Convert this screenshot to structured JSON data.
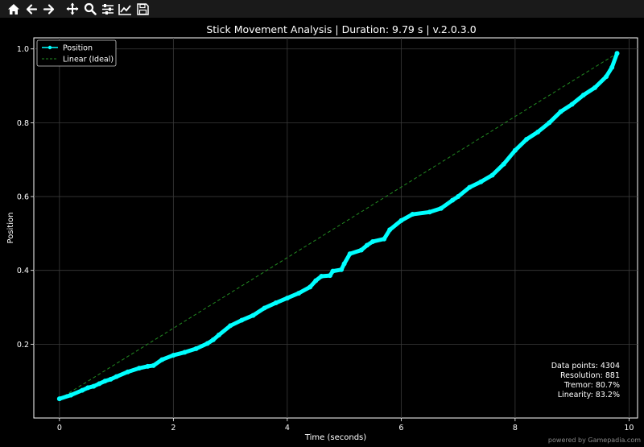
{
  "toolbar": {
    "buttons": [
      {
        "name": "home-icon"
      },
      {
        "name": "back-icon"
      },
      {
        "name": "forward-icon"
      },
      {
        "name": "pan-icon"
      },
      {
        "name": "zoom-icon"
      },
      {
        "name": "subplots-icon"
      },
      {
        "name": "edit-axes-icon"
      },
      {
        "name": "save-icon"
      }
    ],
    "icon_color": "#ffffff",
    "background": "#1a1a1a"
  },
  "chart_data": {
    "type": "line",
    "title": "Stick Movement Analysis | Duration: 9.79 s | v.2.0.3.0",
    "xlabel": "Time (seconds)",
    "ylabel": "Position",
    "xlim": [
      -0.45,
      10.15
    ],
    "ylim": [
      0.0,
      1.03
    ],
    "xticks": [
      0,
      2,
      4,
      6,
      8,
      10
    ],
    "xtick_labels": [
      "0",
      "2",
      "4",
      "6",
      "8",
      "10"
    ],
    "yticks": [
      0.2,
      0.4,
      0.6,
      0.8,
      1.0
    ],
    "ytick_labels": [
      "0.2",
      "0.4",
      "0.6",
      "0.8",
      "1.0"
    ],
    "grid": true,
    "legend_position": "top-left",
    "series": [
      {
        "name": "Position",
        "color": "#00ffff",
        "style": "solid-with-markers",
        "x": [
          0.0,
          0.2,
          0.4,
          0.5,
          0.6,
          0.7,
          0.8,
          0.9,
          1.0,
          1.2,
          1.4,
          1.55,
          1.65,
          1.8,
          2.0,
          2.2,
          2.4,
          2.6,
          2.7,
          2.8,
          3.0,
          3.2,
          3.4,
          3.6,
          3.8,
          4.0,
          4.2,
          4.4,
          4.5,
          4.6,
          4.75,
          4.8,
          4.95,
          5.0,
          5.1,
          5.3,
          5.4,
          5.5,
          5.7,
          5.8,
          6.0,
          6.2,
          6.5,
          6.7,
          6.9,
          7.0,
          7.2,
          7.4,
          7.6,
          7.8,
          8.0,
          8.2,
          8.4,
          8.6,
          8.8,
          9.0,
          9.2,
          9.4,
          9.6,
          9.7,
          9.79
        ],
        "values": [
          0.052,
          0.062,
          0.075,
          0.082,
          0.086,
          0.093,
          0.1,
          0.105,
          0.112,
          0.125,
          0.135,
          0.14,
          0.142,
          0.158,
          0.17,
          0.178,
          0.188,
          0.202,
          0.212,
          0.225,
          0.25,
          0.265,
          0.278,
          0.298,
          0.312,
          0.325,
          0.338,
          0.355,
          0.372,
          0.384,
          0.386,
          0.398,
          0.402,
          0.418,
          0.445,
          0.455,
          0.468,
          0.478,
          0.485,
          0.51,
          0.535,
          0.552,
          0.558,
          0.568,
          0.59,
          0.6,
          0.625,
          0.64,
          0.658,
          0.688,
          0.725,
          0.755,
          0.775,
          0.8,
          0.83,
          0.85,
          0.875,
          0.895,
          0.925,
          0.95,
          0.988
        ]
      },
      {
        "name": "Linear (Ideal)",
        "color": "#228b22",
        "style": "dashed",
        "x": [
          0.0,
          9.79
        ],
        "values": [
          0.052,
          0.988
        ]
      }
    ],
    "stats": [
      "Data points: 4304",
      "Resolution: 881",
      "Tremor: 80.7%",
      "Linearity: 83.2%"
    ]
  },
  "watermark": "powered by Gamepadia.com"
}
